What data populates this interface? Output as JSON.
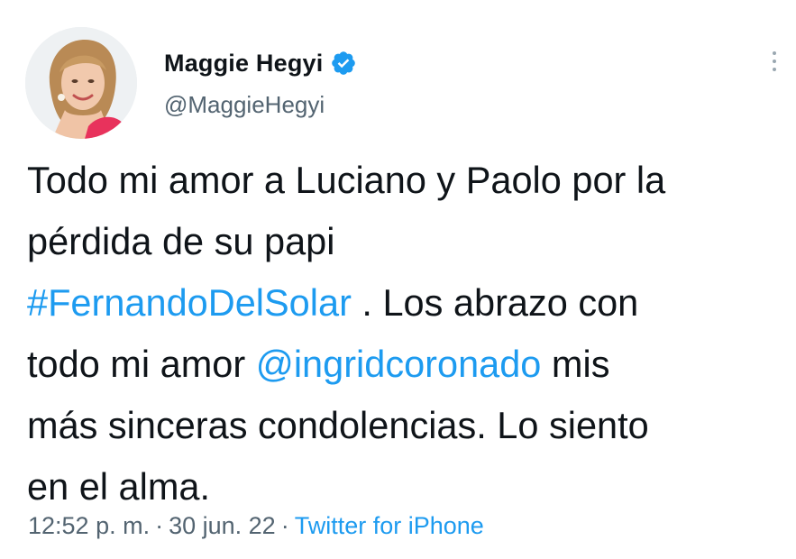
{
  "tweet": {
    "author": {
      "display_name": "Maggie Hegyi",
      "handle": "@MaggieHegyi",
      "verified": true,
      "verified_icon": "verified-badge-icon"
    },
    "more_icon": "more-vertical-icon",
    "text_lines": [
      [
        {
          "text": "Todo mi amor a Luciano y Paolo por la",
          "link": false
        }
      ],
      [
        {
          "text": "pérdida de su papi",
          "link": false
        }
      ],
      [
        {
          "text": "#FernandoDelSolar",
          "link": true
        },
        {
          "text": " . Los abrazo con",
          "link": false
        }
      ],
      [
        {
          "text": "todo mi amor ",
          "link": false
        },
        {
          "text": "@ingridcoronado",
          "link": true
        },
        {
          "text": " mis",
          "link": false
        }
      ],
      [
        {
          "text": "más sinceras condolencias. Lo siento",
          "link": false
        }
      ],
      [
        {
          "text": "en el alma.",
          "link": false
        }
      ]
    ],
    "time": "12:52 p. m.",
    "date": "30 jun. 22",
    "separator": "·",
    "source": "Twitter for iPhone"
  },
  "colors": {
    "text": "#0f1419",
    "secondary": "#536471",
    "link": "#1d9bf0",
    "verified": "#1d9bf0"
  }
}
